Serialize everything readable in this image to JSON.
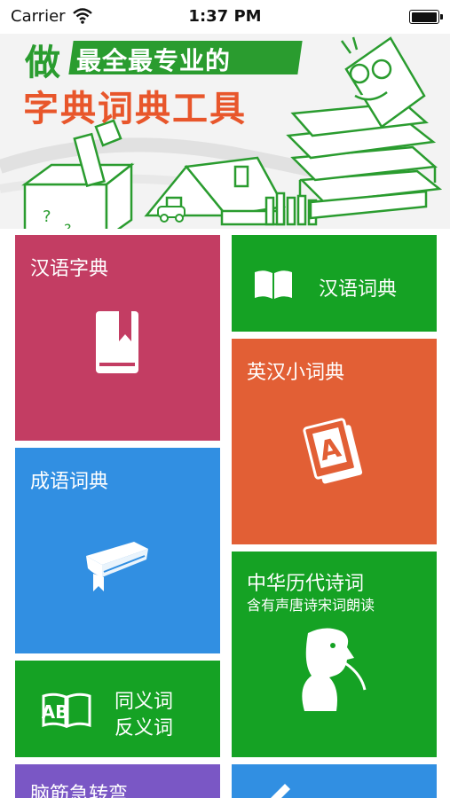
{
  "status_bar": {
    "carrier": "Carrier",
    "time": "1:37 PM",
    "battery_icon": "battery-icon",
    "wifi_icon": "wifi-icon"
  },
  "banner": {
    "title_prefix": "做",
    "title_line1": "最全最专业的",
    "title_line2": "字典词典工具",
    "colors": {
      "green": "#2a9c2f",
      "orange": "#e8562b"
    }
  },
  "tiles": [
    {
      "label": "汉语字典",
      "color": "#c33d63",
      "icon": "bookmark-book-icon"
    },
    {
      "label": "汉语词典",
      "color": "#15a224",
      "icon": "open-book-icon"
    },
    {
      "label": "英汉小词典",
      "color": "#e25f35",
      "icon": "letter-a-book-icon"
    },
    {
      "label": "成语词典",
      "color": "#318fe2",
      "icon": "graduation-book-icon"
    },
    {
      "label": "中华历代诗词",
      "sublabel": "含有声唐诗宋词朗读",
      "color": "#15a224",
      "icon": "poet-icon"
    },
    {
      "label_line1": "同义词",
      "label_line2": "反义词",
      "icon_text": "AB",
      "color": "#15a224",
      "icon": "ab-book-icon"
    },
    {
      "label": "脑筋急转弯",
      "color": "#7a57c5"
    },
    {
      "color": "#318fe2",
      "icon": "pen-icon"
    }
  ]
}
